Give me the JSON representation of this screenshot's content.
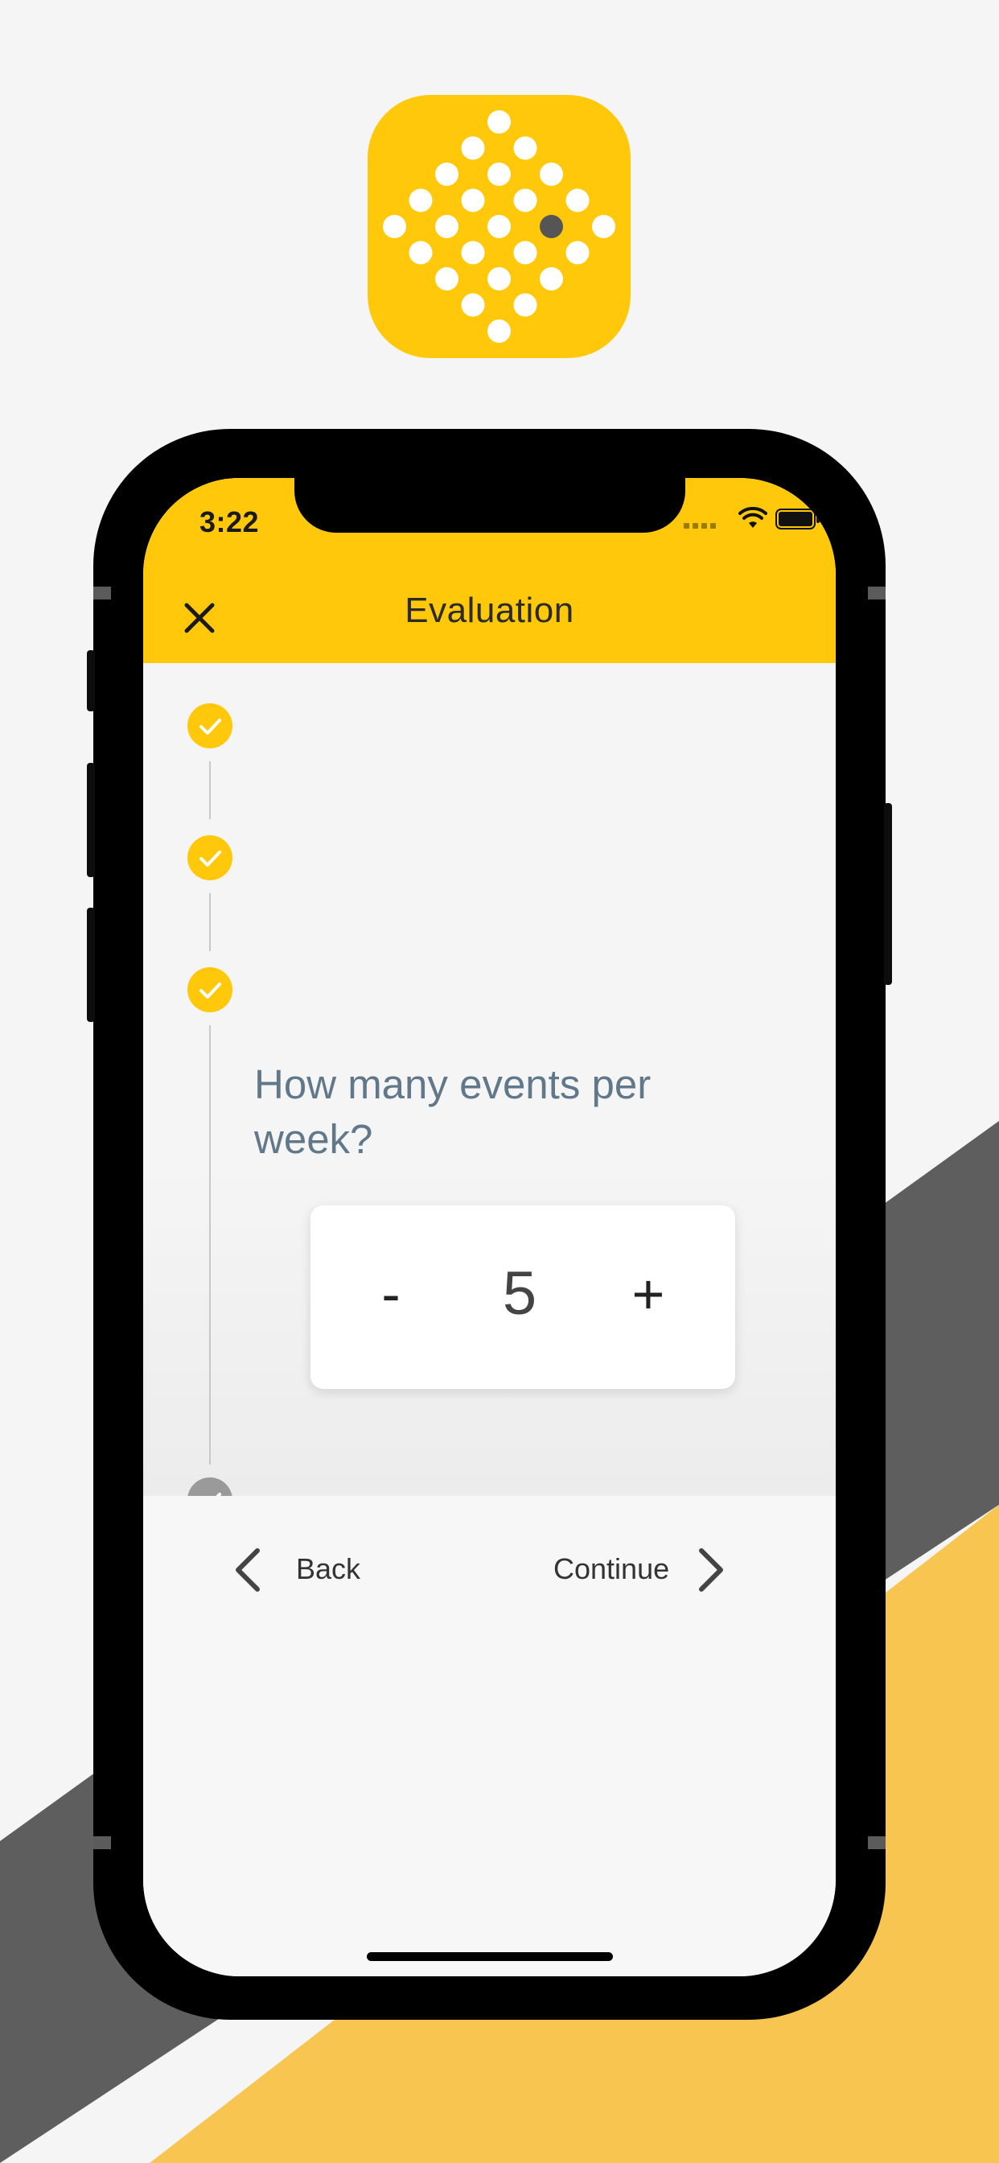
{
  "colors": {
    "accent": "#ffc80a",
    "background": "#f5f5f5",
    "dark_band": "#5e5e5e",
    "yellow_band": "#f7c550",
    "question_text": "#607889",
    "pending_step": "#9a9a9a"
  },
  "app_icon": {
    "name": "dot-diamond-logo"
  },
  "status_bar": {
    "time": "3:22",
    "icons": [
      "signal-icon",
      "wifi-icon",
      "battery-icon"
    ]
  },
  "header": {
    "title": "Evaluation",
    "close_icon": "close-icon"
  },
  "steps": [
    {
      "state": "completed",
      "icon": "check-icon"
    },
    {
      "state": "completed",
      "icon": "check-icon"
    },
    {
      "state": "current",
      "icon": "check-icon"
    },
    {
      "state": "pending",
      "icon": "check-icon"
    }
  ],
  "question": {
    "text": "How many events per week?"
  },
  "stepper": {
    "minus_label": "-",
    "value": "5",
    "plus_label": "+"
  },
  "footer": {
    "back_label": "Back",
    "continue_label": "Continue"
  }
}
